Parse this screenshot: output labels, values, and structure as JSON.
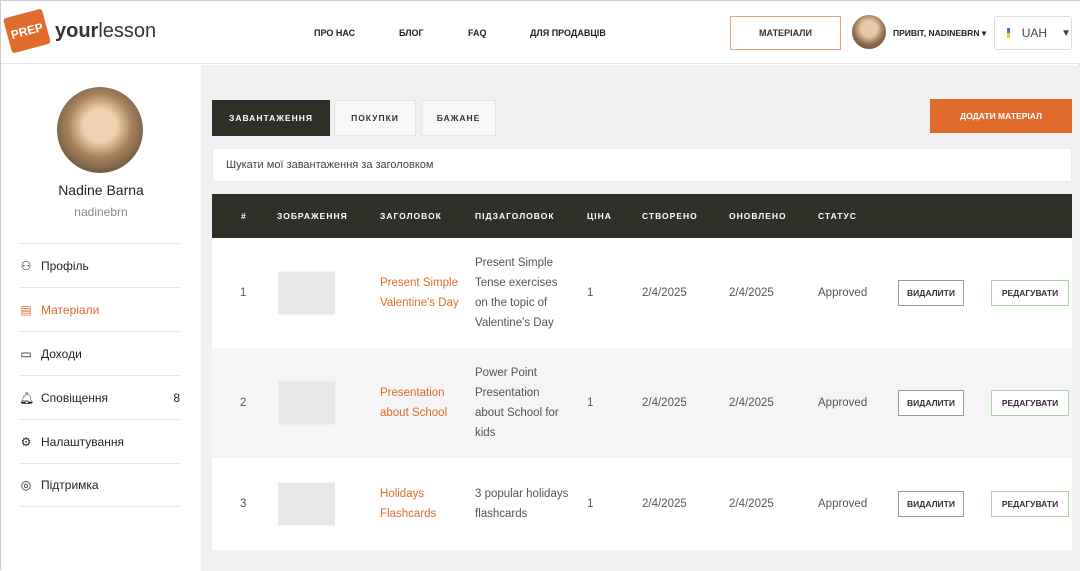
{
  "header": {
    "logo_badge": "PREP",
    "logo_bold": "your",
    "logo_light": "lesson",
    "nav": [
      "ПРО НАС",
      "БЛОГ",
      "FAQ",
      "ДЛЯ ПРОДАВЦІВ"
    ],
    "materials": "МАТЕРІАЛИ",
    "greeting": "ПРИВІТ, NADINEBRN",
    "currency": "UAH"
  },
  "sidebar": {
    "name": "Nadine Barna",
    "username": "nadinebrn",
    "items": [
      {
        "label": "Профіль",
        "icon": "user-icon"
      },
      {
        "label": "Матеріали",
        "icon": "document-icon"
      },
      {
        "label": "Доходи",
        "icon": "wallet-icon"
      },
      {
        "label": "Сповіщення",
        "icon": "bell-icon",
        "count": "8"
      },
      {
        "label": "Налаштування",
        "icon": "gear-icon"
      },
      {
        "label": "Підтримка",
        "icon": "lifebuoy-icon"
      }
    ]
  },
  "main": {
    "tabs": [
      "ЗАВАНТАЖЕННЯ",
      "ПОКУПКИ",
      "БАЖАНЕ"
    ],
    "add_button": "ДОДАТИ МАТЕРІАЛ",
    "search_placeholder": "Шукати мої завантаження за заголовком",
    "columns": [
      "#",
      "ЗОБРАЖЕННЯ",
      "ЗАГОЛОВОК",
      "ПІДЗАГОЛОВОК",
      "ЦІНА",
      "СТВОРЕНО",
      "ОНОВЛЕНО",
      "СТАТУС"
    ],
    "rows": [
      {
        "num": "1",
        "title": "Present Simple Valentine's Day",
        "subtitle": "Present Simple Tense exercises on the topic of Valentine's Day",
        "price": "1",
        "created": "2/4/2025",
        "updated": "2/4/2025",
        "status": "Approved"
      },
      {
        "num": "2",
        "title": "Presentation about School",
        "subtitle": "Power Point Presentation about School for kids",
        "price": "1",
        "created": "2/4/2025",
        "updated": "2/4/2025",
        "status": "Approved"
      },
      {
        "num": "3",
        "title": "Holidays Flashcards",
        "subtitle": "3 popular holidays flashcards",
        "price": "1",
        "created": "2/4/2025",
        "updated": "2/4/2025",
        "status": "Approved"
      }
    ],
    "delete_label": "ВИДАЛИТИ",
    "edit_label": "РЕДАГУВАТИ"
  },
  "colors": {
    "accent": "#e06b2c",
    "dark": "#2d3128"
  }
}
